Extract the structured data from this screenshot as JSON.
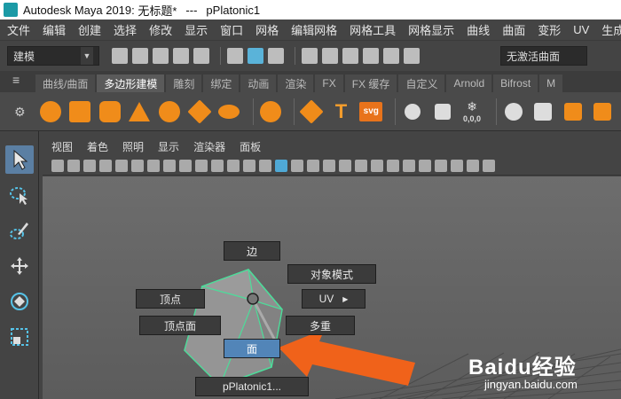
{
  "window": {
    "app_title": "Autodesk Maya 2019: ",
    "file_name": "无标题*",
    "separator": "---",
    "object_name": "pPlatonic1"
  },
  "menubar": [
    "文件",
    "编辑",
    "创建",
    "选择",
    "修改",
    "显示",
    "窗口",
    "网格",
    "编辑网格",
    "网格工具",
    "网格显示",
    "曲线",
    "曲面",
    "变形",
    "UV",
    "生成"
  ],
  "statusline": {
    "mode": "建模",
    "renderer_value": "无激活曲面"
  },
  "shelf_tabs": [
    {
      "label": "曲线/曲面",
      "active": false
    },
    {
      "label": "多边形建模",
      "active": true
    },
    {
      "label": "雕刻",
      "active": false
    },
    {
      "label": "绑定",
      "active": false
    },
    {
      "label": "动画",
      "active": false
    },
    {
      "label": "渲染",
      "active": false
    },
    {
      "label": "FX",
      "active": false
    },
    {
      "label": "FX 缓存",
      "active": false
    },
    {
      "label": "自定义",
      "active": false
    },
    {
      "label": "Arnold",
      "active": false
    },
    {
      "label": "Bifrost",
      "active": false
    },
    {
      "label": "M",
      "active": false
    }
  ],
  "shelf": {
    "text_tool_glyph": "T",
    "svg_tool_label": "svg",
    "counter_label": "0,0,0"
  },
  "panel_menu": [
    "视图",
    "着色",
    "照明",
    "显示",
    "渲染器",
    "面板"
  ],
  "marking_menu": {
    "top": "边",
    "object_mode": "对象模式",
    "vertex": "顶点",
    "uv": "UV",
    "uv_arrow": "▶",
    "vertex_face": "顶点面",
    "multi": "多重",
    "face": "面",
    "object_name": "pPlatonic1..."
  },
  "colors": {
    "accent_highlight": "#5285b8",
    "shelf_orange": "#f08c1a",
    "arrow_orange": "#f0621a",
    "selection_green": "#4ddc9a"
  },
  "watermark": {
    "brand": "Baidu经验",
    "url": "jingyan.baidu.com"
  }
}
